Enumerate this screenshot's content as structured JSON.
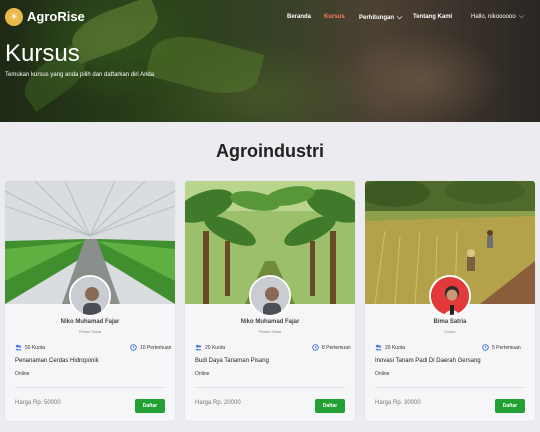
{
  "brand": {
    "name": "AgroRise",
    "logo_icon": "sun-logo-icon",
    "accent": "#e9b949"
  },
  "nav": {
    "items": [
      {
        "label": "Beranda",
        "active": false
      },
      {
        "label": "Kursus",
        "active": true
      },
      {
        "label": "Perhitungan",
        "dropdown": true
      },
      {
        "label": "Tentang Kami",
        "active": false
      }
    ],
    "user_greeting": "Hallo, nikoooooo",
    "active_color": "#ff7a5a"
  },
  "hero": {
    "title": "Kursus",
    "subtitle": "Temukan kursus yang anda pilih dan daftarkan diri Anda"
  },
  "section": {
    "title": "Agroindustri"
  },
  "courses": [
    {
      "mentor_name": "Niko Muhamad Fajar",
      "mentor_role": "Petani Sukai",
      "quota": "50 Kuota",
      "sessions": "10 Pertemuan",
      "title": "Penanaman Cerdas Hidroponik",
      "mode": "Online",
      "price": "Harga Rp. 50000",
      "button": "Daftar"
    },
    {
      "mentor_name": "Niko Muhamad Fajar",
      "mentor_role": "Petani Sukai",
      "quota": "20 Kuota",
      "sessions": "8 Pertemuan",
      "title": "Budi Daya Tanaman Pisang",
      "mode": "Online",
      "price": "Harga Rp. 20000",
      "button": "Daftar"
    },
    {
      "mentor_name": "Bima Satria",
      "mentor_role": "Dosen",
      "quota": "20 Kuota",
      "sessions": "5 Pertemuan",
      "title": "Inovasi Tanam Padi Di Daerah Gersang",
      "mode": "Online",
      "price": "Harga Rp. 30000",
      "button": "Daftar"
    }
  ],
  "colors": {
    "button": "#22a033",
    "quota_icon": "#3b6fd8",
    "session_icon": "#3b6fd8"
  }
}
